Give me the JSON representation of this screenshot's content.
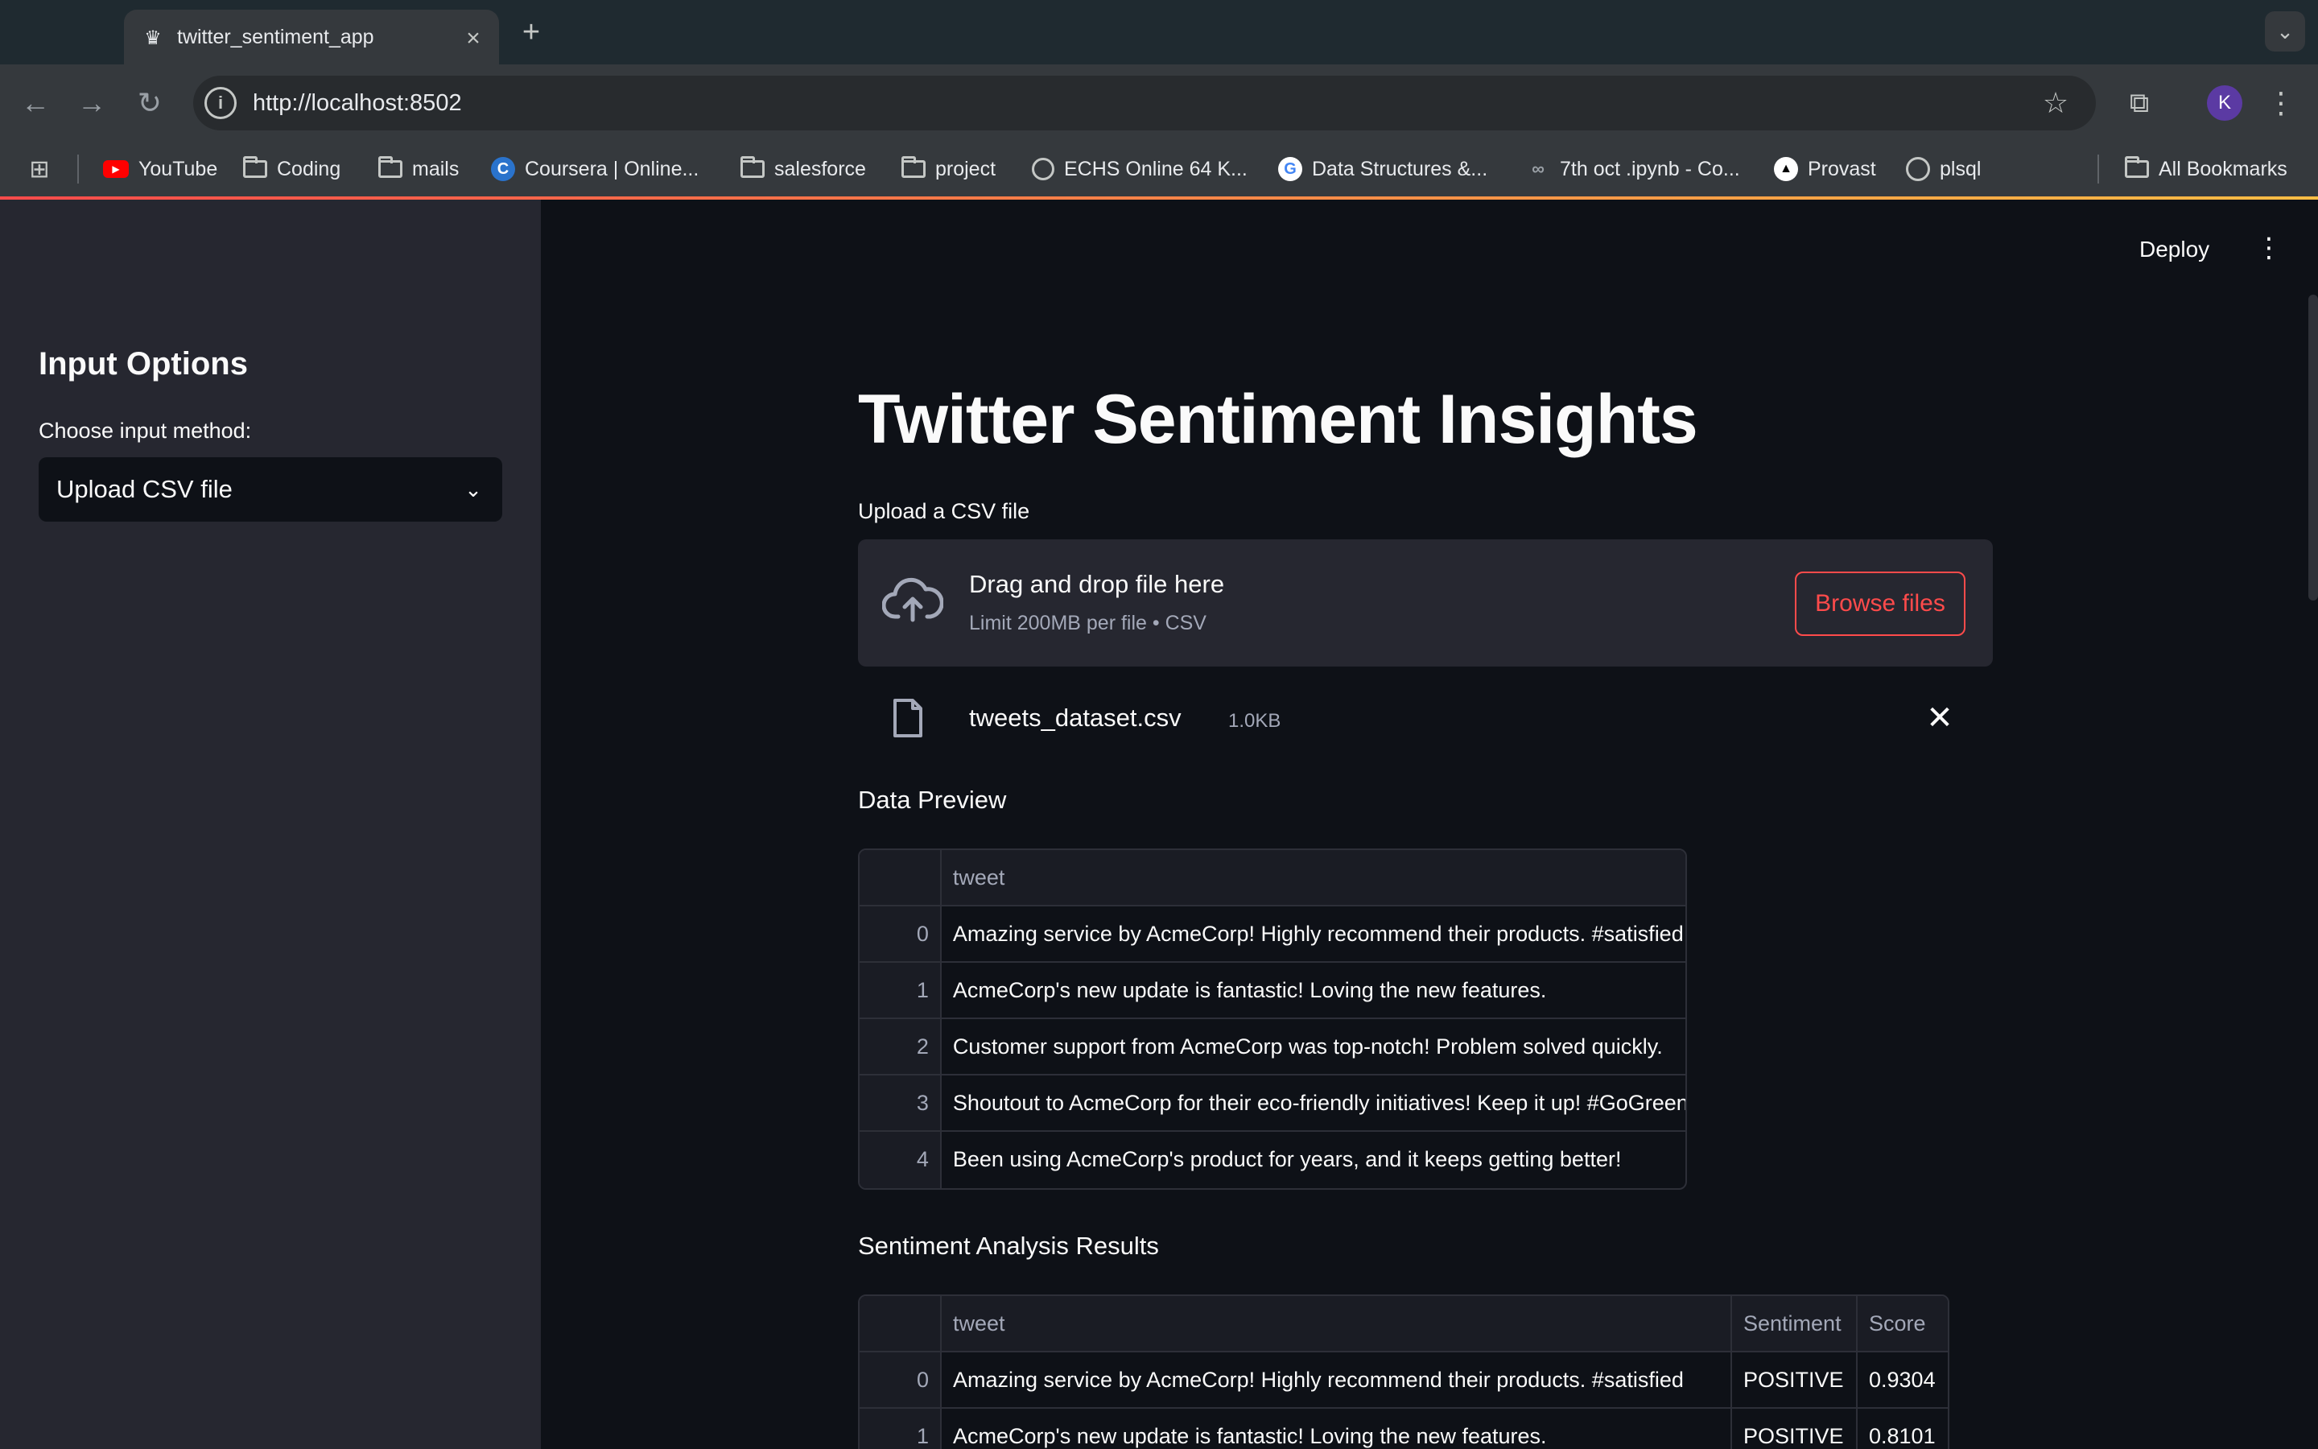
{
  "browser": {
    "tab_title": "twitter_sentiment_app",
    "url": "http://localhost:8502",
    "profile_initial": "K",
    "bookmarks": [
      {
        "label": "YouTube",
        "icon": "youtube-icon"
      },
      {
        "label": "Coding",
        "icon": "folder-icon"
      },
      {
        "label": "mails",
        "icon": "folder-icon"
      },
      {
        "label": "Coursera | Online...",
        "icon": "coursera-icon"
      },
      {
        "label": "salesforce",
        "icon": "folder-icon"
      },
      {
        "label": "project",
        "icon": "folder-icon"
      },
      {
        "label": "ECHS Online 64 K...",
        "icon": "globe-icon"
      },
      {
        "label": "Data Structures &...",
        "icon": "google-icon"
      },
      {
        "label": "7th oct .ipynb - Co...",
        "icon": "colab-icon"
      },
      {
        "label": "Provast",
        "icon": "provast-icon"
      },
      {
        "label": "plsql",
        "icon": "chatgpt-icon"
      }
    ],
    "all_bookmarks": "All Bookmarks"
  },
  "sidebar": {
    "heading": "Input Options",
    "method_label": "Choose input method:",
    "method_value": "Upload CSV file"
  },
  "header": {
    "deploy": "Deploy"
  },
  "main": {
    "title": "Twitter Sentiment Insights",
    "upload_label": "Upload a CSV file",
    "dropzone_main": "Drag and drop file here",
    "dropzone_sub": "Limit 200MB per file • CSV",
    "browse_label": "Browse files",
    "file_name": "tweets_dataset.csv",
    "file_size": "1.0KB",
    "preview_heading": "Data Preview",
    "preview_table": {
      "columns": [
        "",
        "tweet"
      ],
      "rows": [
        [
          "0",
          "Amazing service by AcmeCorp! Highly recommend their products. #satisfied"
        ],
        [
          "1",
          "AcmeCorp's new update is fantastic! Loving the new features."
        ],
        [
          "2",
          "Customer support from AcmeCorp was top-notch! Problem solved quickly."
        ],
        [
          "3",
          "Shoutout to AcmeCorp for their eco-friendly initiatives! Keep it up! #GoGreen"
        ],
        [
          "4",
          "Been using AcmeCorp's product for years, and it keeps getting better!"
        ]
      ]
    },
    "results_heading": "Sentiment Analysis Results",
    "results_table": {
      "columns": [
        "",
        "tweet",
        "Sentiment",
        "Score"
      ],
      "rows": [
        [
          "0",
          "Amazing service by AcmeCorp! Highly recommend their products. #satisfied",
          "POSITIVE",
          "0.9304"
        ],
        [
          "1",
          "AcmeCorp's new update is fantastic! Loving the new features.",
          "POSITIVE",
          "0.8101"
        ]
      ]
    }
  },
  "colors": {
    "app_bg": "#0e1117",
    "sidebar_bg": "#262730",
    "accent": "#ff4b4b"
  }
}
